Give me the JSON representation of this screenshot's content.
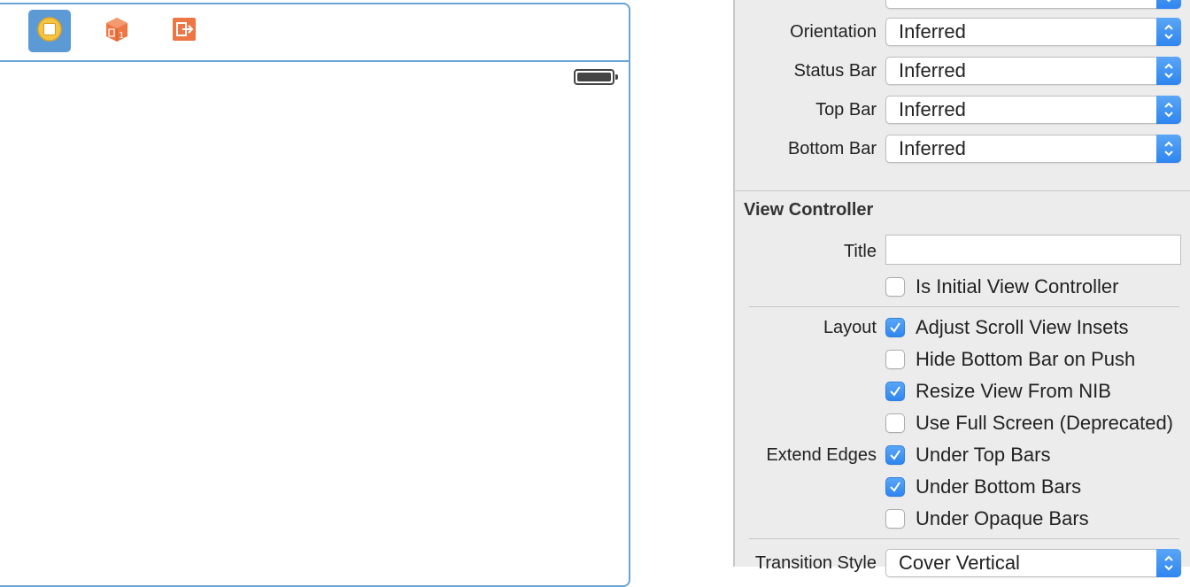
{
  "canvas": {
    "dock": {
      "items": [
        {
          "name": "view-controller-icon",
          "selected": true
        },
        {
          "name": "first-responder-icon",
          "selected": false
        },
        {
          "name": "exit-icon",
          "selected": false
        }
      ]
    },
    "status_icon": "battery-icon"
  },
  "inspector": {
    "simulated_metrics": [
      {
        "label": "Orientation",
        "value": "Inferred"
      },
      {
        "label": "Status Bar",
        "value": "Inferred"
      },
      {
        "label": "Top Bar",
        "value": "Inferred"
      },
      {
        "label": "Bottom Bar",
        "value": "Inferred"
      }
    ],
    "view_controller": {
      "section_title": "View Controller",
      "title_label": "Title",
      "title_value": "",
      "is_initial_label": "Is Initial View Controller",
      "is_initial_checked": false,
      "layout_label": "Layout",
      "layout_options": [
        {
          "label": "Adjust Scroll View Insets",
          "checked": true
        },
        {
          "label": "Hide Bottom Bar on Push",
          "checked": false
        },
        {
          "label": "Resize View From NIB",
          "checked": true
        },
        {
          "label": "Use Full Screen (Deprecated)",
          "checked": false
        }
      ],
      "extend_edges_label": "Extend Edges",
      "extend_edges_options": [
        {
          "label": "Under Top Bars",
          "checked": true
        },
        {
          "label": "Under Bottom Bars",
          "checked": true
        },
        {
          "label": "Under Opaque Bars",
          "checked": false
        }
      ],
      "transition_style_label": "Transition Style",
      "transition_style_value": "Cover Vertical"
    }
  },
  "colors": {
    "accent": "#3b8ff0",
    "scene_border": "#6aa4da",
    "inspector_bg": "#ececec",
    "dock_orange": "#ee7644",
    "dock_yellow": "#f5c542"
  }
}
